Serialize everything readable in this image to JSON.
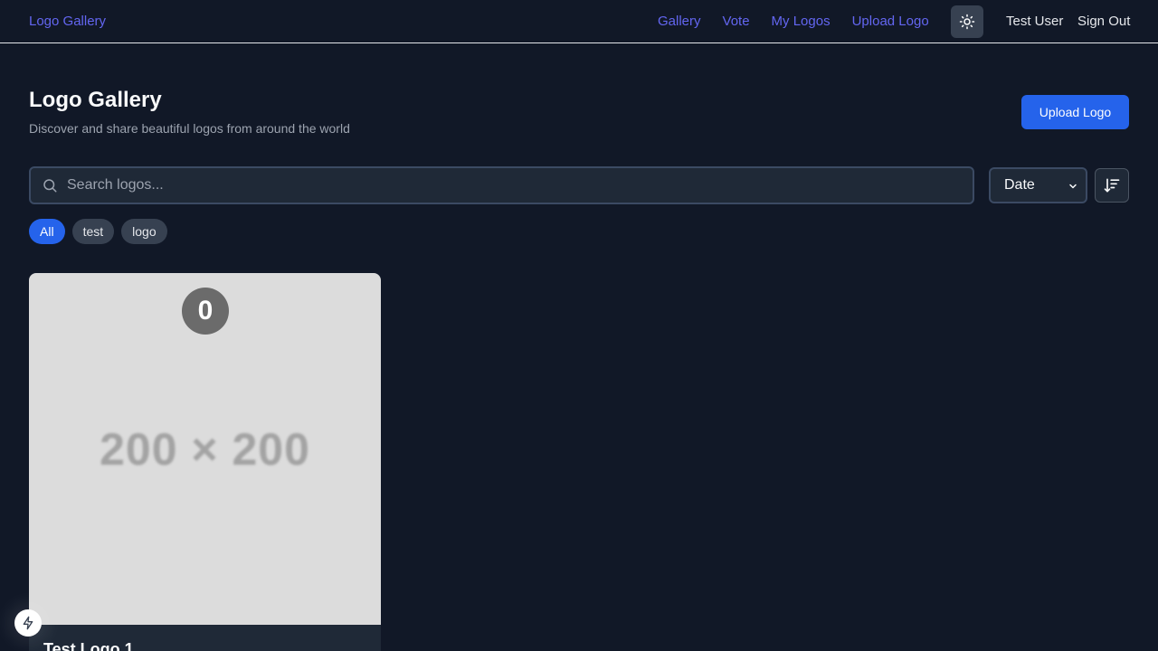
{
  "nav": {
    "brand": "Logo Gallery",
    "links": [
      "Gallery",
      "Vote",
      "My Logos",
      "Upload Logo"
    ],
    "theme_icon": "sun-icon",
    "user": "Test User",
    "sign_out": "Sign Out"
  },
  "header": {
    "title": "Logo Gallery",
    "subtitle": "Discover and share beautiful logos from around the world",
    "upload_label": "Upload Logo"
  },
  "search": {
    "placeholder": "Search logos...",
    "value": ""
  },
  "sort": {
    "selected": "Date",
    "direction_icon": "sort-descending-icon"
  },
  "tags": [
    "All",
    "test",
    "logo"
  ],
  "active_tag": "All",
  "cards": [
    {
      "image_text": "200 × 200",
      "votes": "0",
      "title": "Test Logo 1"
    }
  ],
  "colors": {
    "background": "#111827",
    "accent": "#2563eb",
    "nav_link": "#6366f1"
  }
}
